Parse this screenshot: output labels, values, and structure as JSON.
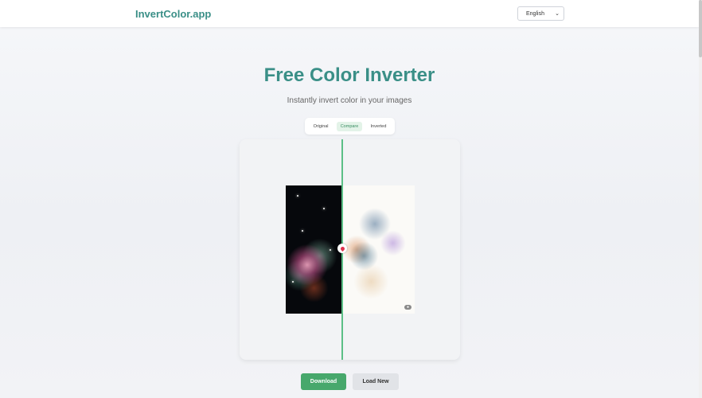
{
  "header": {
    "brand": "InvertColor.app",
    "language_selected": "English"
  },
  "hero": {
    "title": "Free Color Inverter",
    "subtitle": "Instantly invert color in your images"
  },
  "view_modes": [
    {
      "label": "Original",
      "active": false
    },
    {
      "label": "Compare",
      "active": true
    },
    {
      "label": "Inverted",
      "active": false
    }
  ],
  "actions": {
    "download_label": "Download",
    "load_new_label": "Load New"
  },
  "colors": {
    "brand": "#3a8f87",
    "accent_green": "#47a86c",
    "divider": "#5cbf86"
  }
}
